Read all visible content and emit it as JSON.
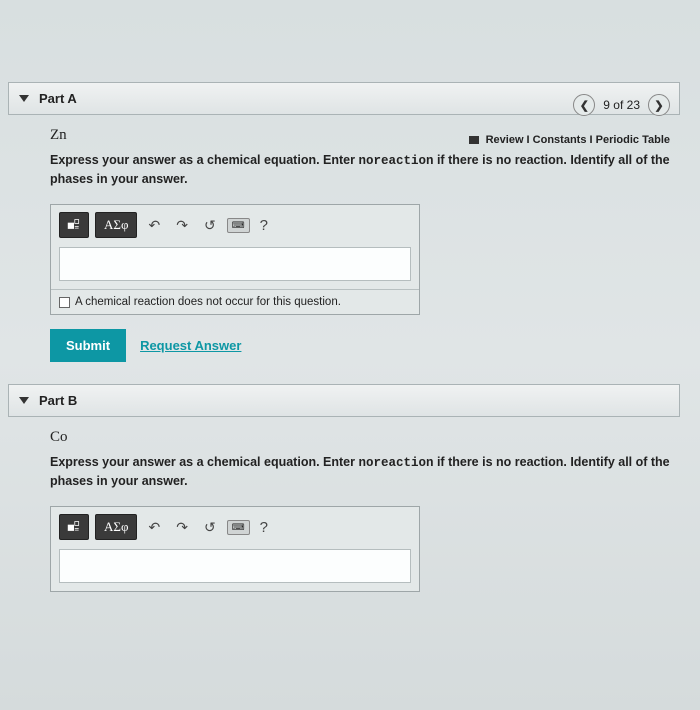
{
  "nav": {
    "position": "9 of 23"
  },
  "review_bar": "Review I Constants I Periodic Table",
  "partA": {
    "title": "Part A",
    "element": "Zn",
    "instruction_pre": "Express your answer as a chemical equation. Enter ",
    "instruction_mono": "noreaction",
    "instruction_post": " if there is no reaction. Identify all of the phases in your answer.",
    "greek": "ΑΣφ",
    "no_reaction": "A chemical reaction does not occur for this question.",
    "submit": "Submit",
    "request": "Request Answer",
    "help": "?"
  },
  "partB": {
    "title": "Part B",
    "element": "Co",
    "instruction_pre": "Express your answer as a chemical equation. Enter ",
    "instruction_mono": "noreaction",
    "instruction_post": " if there is no reaction. Identify all of the phases in your answer.",
    "greek": "ΑΣφ",
    "help": "?"
  }
}
